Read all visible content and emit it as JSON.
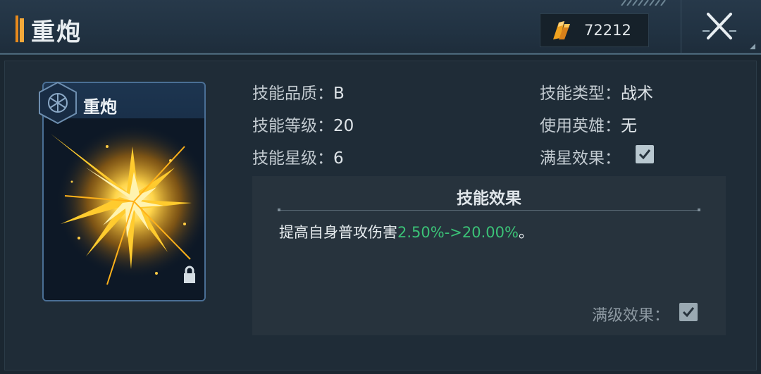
{
  "header": {
    "title": "重炮",
    "currency": {
      "icon": "gold-crystal-icon",
      "amount": "72212"
    },
    "close_icon": "close-icon"
  },
  "card": {
    "title": "重炮",
    "badge_icon": "hexagon-emblem-icon",
    "art": "explosion-burst-art",
    "lock_icon": "lock-icon"
  },
  "info": {
    "quality": {
      "label": "技能品质：",
      "value": "B"
    },
    "level": {
      "label": "技能等级：",
      "value": "20"
    },
    "star": {
      "label": "技能星级：",
      "value": "6"
    },
    "type": {
      "label": "技能类型：",
      "value": "战术"
    },
    "hero": {
      "label": "使用英雄：",
      "value": "无"
    },
    "full_star": {
      "label": "满星效果：",
      "checked": true
    }
  },
  "effect": {
    "title": "技能效果",
    "desc_prefix": "提高自身普攻伤害",
    "desc_highlight": "2.50%->20.00%",
    "desc_suffix": "。",
    "max_level": {
      "label": "满级效果：",
      "checked": true
    }
  },
  "colors": {
    "accent_orange": "#f3a93a",
    "highlight_green": "#3bc277",
    "panel_bg": "#1f2c37"
  }
}
